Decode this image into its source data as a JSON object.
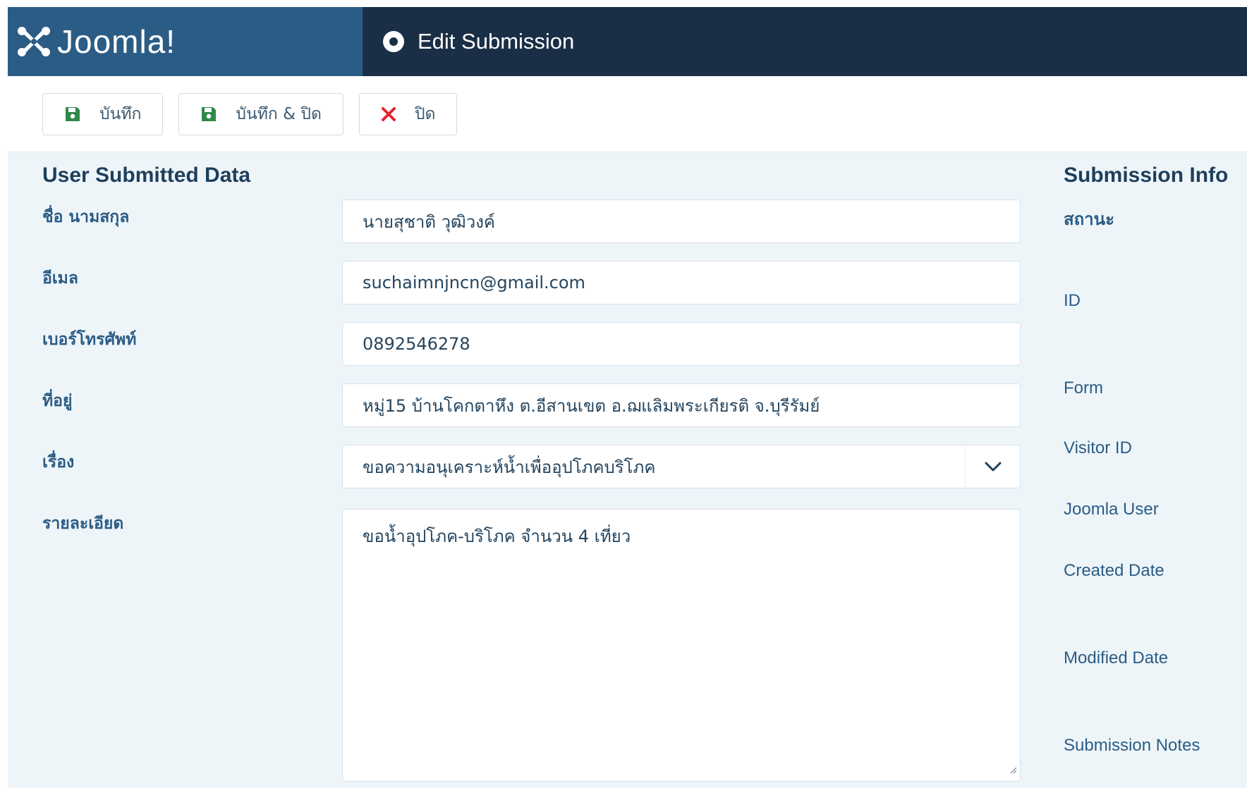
{
  "header": {
    "brand": "Joomla!",
    "title": "Edit Submission"
  },
  "toolbar": {
    "save_label": "บันทึก",
    "save_close_label": "บันทึก & ปิด",
    "close_label": "ปิด"
  },
  "user_data": {
    "title": "User Submitted Data",
    "fields": [
      {
        "label": "ชื่อ นามสกุล",
        "value": "นายสุชาติ วุฒิวงค์"
      },
      {
        "label": "อีเมล",
        "value": "suchaimnjncn@gmail.com"
      },
      {
        "label": "เบอร์โทรศัพท์",
        "value": "0892546278"
      },
      {
        "label": "ที่อยู่",
        "value": "หมู่15 บ้านโคกตาหึง ต.อีสานเขต อ.ฌแลิมพระเกียรติ จ.บุรีรัมย์"
      },
      {
        "label": "เรื่อง",
        "value": "ขอความอนุเคราะห์น้ำเพื่ออุปโภคบริโภค"
      },
      {
        "label": "รายละเอียด",
        "value": "ขอน้ำอุปโภค-บริโภค จำนวน 4 เที่ยว"
      }
    ]
  },
  "submission_info": {
    "title": "Submission Info",
    "labels": [
      "สถานะ",
      "ID",
      "Form",
      "Visitor ID",
      "Joomla User",
      "Created Date",
      "Modified Date",
      "Submission Notes"
    ]
  },
  "colors": {
    "header_bg": "#1a2f45",
    "brand_bg": "#2b5c85",
    "page_bg": "#eef5f9",
    "label_color": "#2b5c85",
    "close_icon": "#e2262e",
    "save_icon": "#2f8a4a"
  }
}
